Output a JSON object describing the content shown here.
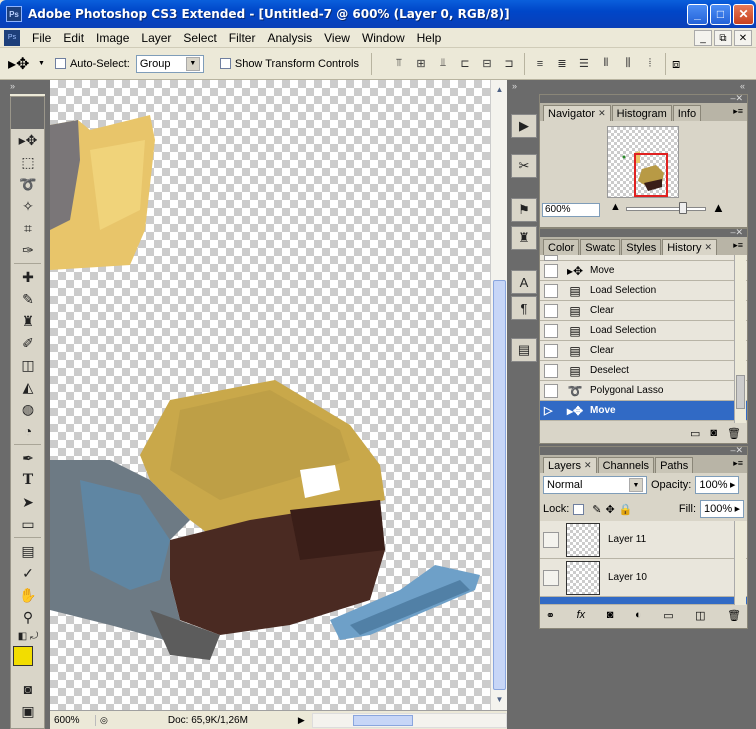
{
  "window": {
    "title": "Adobe Photoshop CS3 Extended - [Untitled-7 @ 600% (Layer 0, RGB/8)]",
    "app_icon": "Ps",
    "minimize": "_",
    "maximize": "□",
    "close": "✕"
  },
  "menu": {
    "items": [
      "File",
      "Edit",
      "Image",
      "Layer",
      "Select",
      "Filter",
      "Analysis",
      "View",
      "Window",
      "Help"
    ],
    "doc_controls": [
      "_",
      "⧉",
      "✕"
    ]
  },
  "options": {
    "auto_select_label": "Auto-Select:",
    "auto_select_value": "Group",
    "show_transform_label": "Show Transform Controls"
  },
  "navigator": {
    "tabs": [
      "Navigator",
      "Histogram",
      "Info"
    ],
    "zoom": "600%"
  },
  "history": {
    "tabs": [
      "Color",
      "Swatc",
      "Styles",
      "History"
    ],
    "items": [
      {
        "label": "Move",
        "icon": "move-tool-icon"
      },
      {
        "label": "Load Selection",
        "icon": "history-state-icon"
      },
      {
        "label": "Clear",
        "icon": "history-state-icon"
      },
      {
        "label": "Load Selection",
        "icon": "history-state-icon"
      },
      {
        "label": "Clear",
        "icon": "history-state-icon"
      },
      {
        "label": "Deselect",
        "icon": "history-state-icon"
      },
      {
        "label": "Polygonal Lasso",
        "icon": "lasso-icon"
      },
      {
        "label": "Move",
        "icon": "move-tool-icon",
        "selected": true
      }
    ]
  },
  "layers": {
    "tabs": [
      "Layers",
      "Channels",
      "Paths"
    ],
    "blend_mode": "Normal",
    "opacity_label": "Opacity:",
    "opacity": "100%",
    "lock_label": "Lock:",
    "fill_label": "Fill:",
    "fill": "100%",
    "items": [
      "Layer 11",
      "Layer 10"
    ]
  },
  "status": {
    "zoom": "600%",
    "doc": "Doc: 65,9K/1,26M"
  },
  "colors": {
    "foreground": "#f2dd00",
    "selection": "#316ac5"
  }
}
